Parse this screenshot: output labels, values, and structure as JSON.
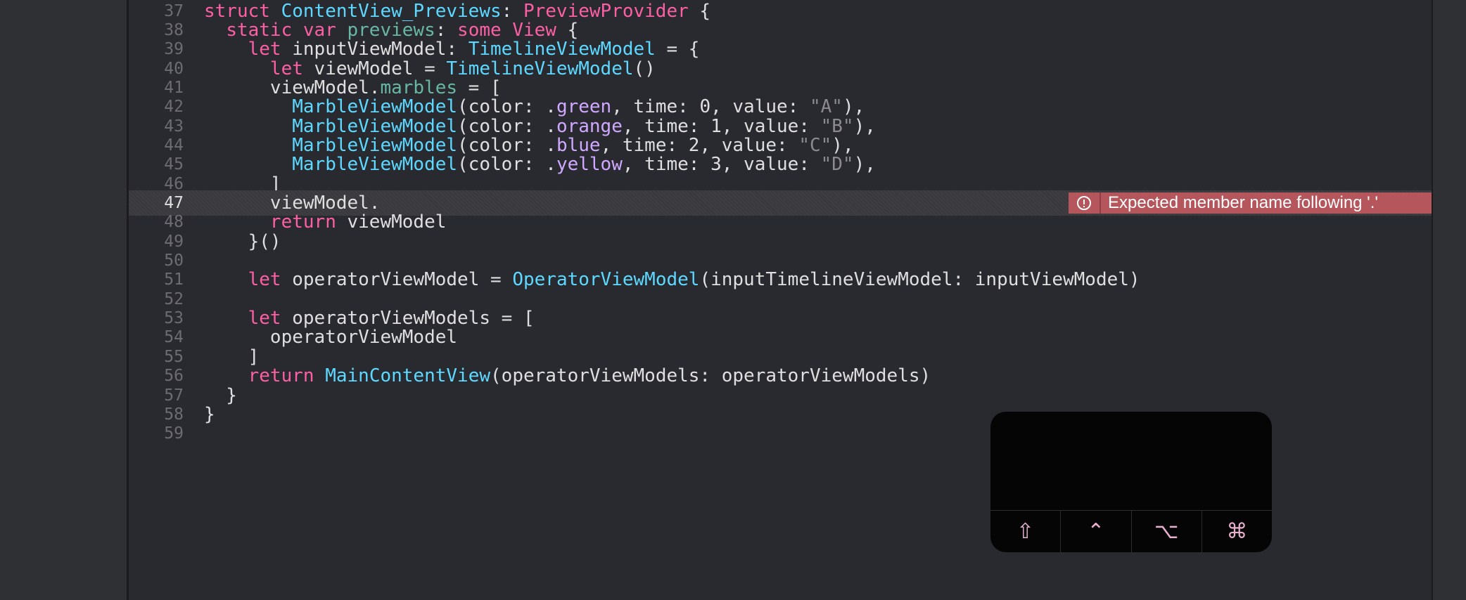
{
  "editor": {
    "lines": [
      {
        "n": "37",
        "segs": [
          [
            "kw",
            "struct "
          ],
          [
            "ty",
            "ContentView_Previews"
          ],
          [
            "pl",
            ": "
          ],
          [
            "kw",
            "PreviewProvider"
          ],
          [
            "pl",
            " {"
          ]
        ]
      },
      {
        "n": "38",
        "segs": [
          [
            "pl",
            "  "
          ],
          [
            "kw",
            "static var "
          ],
          [
            "pr",
            "previews"
          ],
          [
            "pl",
            ": "
          ],
          [
            "kw",
            "some "
          ],
          [
            "kw",
            "View"
          ],
          [
            "pl",
            " {"
          ]
        ]
      },
      {
        "n": "39",
        "segs": [
          [
            "pl",
            "    "
          ],
          [
            "kw",
            "let "
          ],
          [
            "pl",
            "inputViewModel: "
          ],
          [
            "ty",
            "TimelineViewModel"
          ],
          [
            "pl",
            " = {"
          ]
        ]
      },
      {
        "n": "40",
        "segs": [
          [
            "pl",
            "      "
          ],
          [
            "kw",
            "let "
          ],
          [
            "pl",
            "viewModel = "
          ],
          [
            "ty",
            "TimelineViewModel"
          ],
          [
            "pl",
            "()"
          ]
        ]
      },
      {
        "n": "41",
        "segs": [
          [
            "pl",
            "      viewModel."
          ],
          [
            "pr",
            "marbles"
          ],
          [
            "pl",
            " = ["
          ]
        ]
      },
      {
        "n": "42",
        "segs": [
          [
            "pl",
            "        "
          ],
          [
            "ty",
            "MarbleViewModel"
          ],
          [
            "pl",
            "(color: ."
          ],
          [
            "mem",
            "green"
          ],
          [
            "pl",
            ", time: 0, value: "
          ],
          [
            "str",
            "\"A\""
          ],
          [
            "pl",
            "),"
          ]
        ]
      },
      {
        "n": "43",
        "segs": [
          [
            "pl",
            "        "
          ],
          [
            "ty",
            "MarbleViewModel"
          ],
          [
            "pl",
            "(color: ."
          ],
          [
            "mem",
            "orange"
          ],
          [
            "pl",
            ", time: 1, value: "
          ],
          [
            "str",
            "\"B\""
          ],
          [
            "pl",
            "),"
          ]
        ]
      },
      {
        "n": "44",
        "segs": [
          [
            "pl",
            "        "
          ],
          [
            "ty",
            "MarbleViewModel"
          ],
          [
            "pl",
            "(color: ."
          ],
          [
            "mem",
            "blue"
          ],
          [
            "pl",
            ", time: 2, value: "
          ],
          [
            "str",
            "\"C\""
          ],
          [
            "pl",
            "),"
          ]
        ]
      },
      {
        "n": "45",
        "segs": [
          [
            "pl",
            "        "
          ],
          [
            "ty",
            "MarbleViewModel"
          ],
          [
            "pl",
            "(color: ."
          ],
          [
            "mem",
            "yellow"
          ],
          [
            "pl",
            ", time: 3, value: "
          ],
          [
            "str",
            "\"D\""
          ],
          [
            "pl",
            "),"
          ]
        ]
      },
      {
        "n": "46",
        "segs": [
          [
            "pl",
            "      ]"
          ]
        ]
      },
      {
        "n": "47",
        "segs": [
          [
            "pl",
            "      viewModel."
          ]
        ],
        "current": true
      },
      {
        "n": "48",
        "segs": [
          [
            "pl",
            "      "
          ],
          [
            "kw",
            "return "
          ],
          [
            "pl",
            "viewModel"
          ]
        ]
      },
      {
        "n": "49",
        "segs": [
          [
            "pl",
            "    }()"
          ]
        ]
      },
      {
        "n": "50",
        "segs": []
      },
      {
        "n": "51",
        "segs": [
          [
            "pl",
            "    "
          ],
          [
            "kw",
            "let "
          ],
          [
            "pl",
            "operatorViewModel = "
          ],
          [
            "ty",
            "OperatorViewModel"
          ],
          [
            "pl",
            "(inputTimelineViewModel: inputViewModel)"
          ]
        ]
      },
      {
        "n": "52",
        "segs": []
      },
      {
        "n": "53",
        "segs": [
          [
            "pl",
            "    "
          ],
          [
            "kw",
            "let "
          ],
          [
            "pl",
            "operatorViewModels = ["
          ]
        ]
      },
      {
        "n": "54",
        "segs": [
          [
            "pl",
            "      operatorViewModel"
          ]
        ]
      },
      {
        "n": "55",
        "segs": [
          [
            "pl",
            "    ]"
          ]
        ]
      },
      {
        "n": "56",
        "segs": [
          [
            "pl",
            "    "
          ],
          [
            "kw",
            "return "
          ],
          [
            "ty",
            "MainContentView"
          ],
          [
            "pl",
            "(operatorViewModels: operatorViewModels)"
          ]
        ]
      },
      {
        "n": "57",
        "segs": [
          [
            "pl",
            "  }"
          ]
        ]
      },
      {
        "n": "58",
        "segs": [
          [
            "pl",
            "}"
          ]
        ]
      },
      {
        "n": "59",
        "segs": []
      }
    ]
  },
  "error": {
    "message": "Expected member name following '.'",
    "icon": "exclamation-circle-icon",
    "color": "#b5555c"
  },
  "keypad": {
    "keys": [
      {
        "name": "shift-key",
        "glyph": "⇧"
      },
      {
        "name": "control-key",
        "glyph": "⌃"
      },
      {
        "name": "option-key",
        "glyph": "⌥"
      },
      {
        "name": "command-key",
        "glyph": "⌘"
      }
    ]
  },
  "colors": {
    "keyword": "#fc5fa3",
    "type": "#5dd8ff",
    "property": "#67b7a4",
    "member": "#d0a8ff",
    "string": "#8a8a90",
    "plain": "#dfdfe0"
  }
}
